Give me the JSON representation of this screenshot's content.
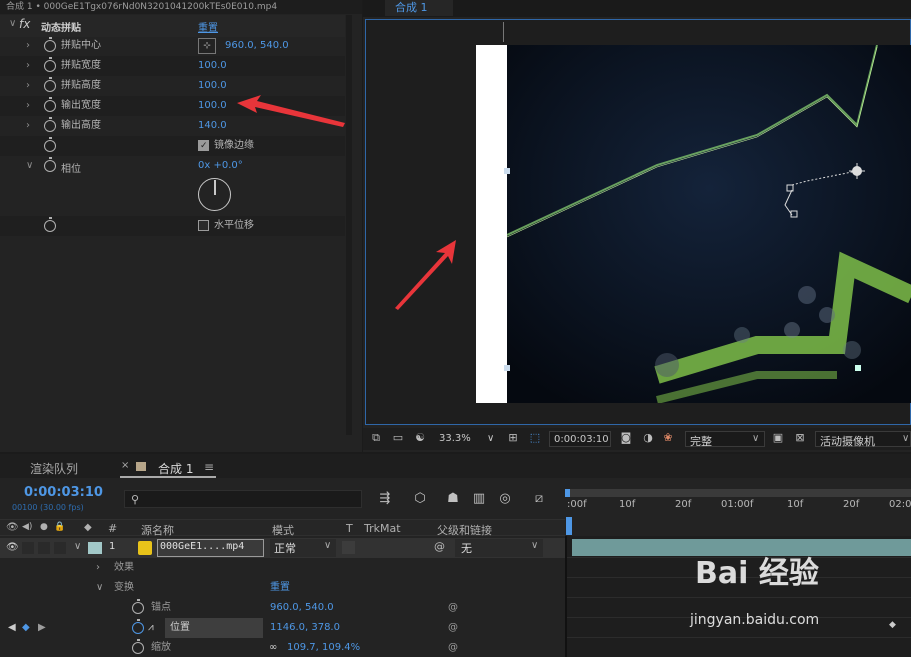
{
  "effects_panel": {
    "title": "合成 1 • 000GeE1Tgx076rNd0N3201041200kTEs0E010.mp4",
    "effect_name": "动态拼贴",
    "reset": "重置",
    "properties": [
      {
        "label": "拼贴中心",
        "value": "960.0, 540.0"
      },
      {
        "label": "拼贴宽度",
        "value": "100.0"
      },
      {
        "label": "拼贴高度",
        "value": "100.0"
      },
      {
        "label": "输出宽度",
        "value": "100.0"
      },
      {
        "label": "输出高度",
        "value": "140.0"
      },
      {
        "label": "镜像边缘",
        "value": ""
      },
      {
        "label": "相位",
        "value": "0x +0.0°"
      },
      {
        "label": "水平位移",
        "value": ""
      }
    ],
    "mirror_checked": true,
    "hshift_checked": false,
    "fx_icon": "fx"
  },
  "viewer": {
    "tab": "合成 1",
    "zoom": "33.3%",
    "timecode": "0:00:03:10",
    "quality": "完整",
    "camera": "活动摄像机"
  },
  "timeline": {
    "tabs": [
      "渲染队列",
      "合成 1"
    ],
    "timecode": "0:00:03:10",
    "fps": "00100 (30.00 fps)",
    "columns": {
      "num": "#",
      "source": "源名称",
      "mode": "模式",
      "t": "T",
      "trkmat": "TrkMat",
      "parent": "父级和链接"
    },
    "layer": {
      "num": "1",
      "name": "000GeE1....mp4",
      "mode": "正常",
      "parent": "无"
    },
    "groups": {
      "effects": "效果",
      "transform": "变换",
      "reset": "重置"
    },
    "props": [
      {
        "label": "锚点",
        "value": "960.0, 540.0"
      },
      {
        "label": "位置",
        "value": "1146.0, 378.0"
      },
      {
        "label": "缩放",
        "value": "109.7, 109.4%"
      }
    ],
    "ruler": [
      ":00f",
      "10f",
      "20f",
      "01:00f",
      "10f",
      "20f",
      "02:0"
    ]
  },
  "watermark": {
    "text": "Bai  经验",
    "url": "jingyan.baidu.com"
  },
  "colors": {
    "accent": "#4e97e5",
    "arrow": "#e8353a",
    "layer": "#6f9a9a"
  }
}
